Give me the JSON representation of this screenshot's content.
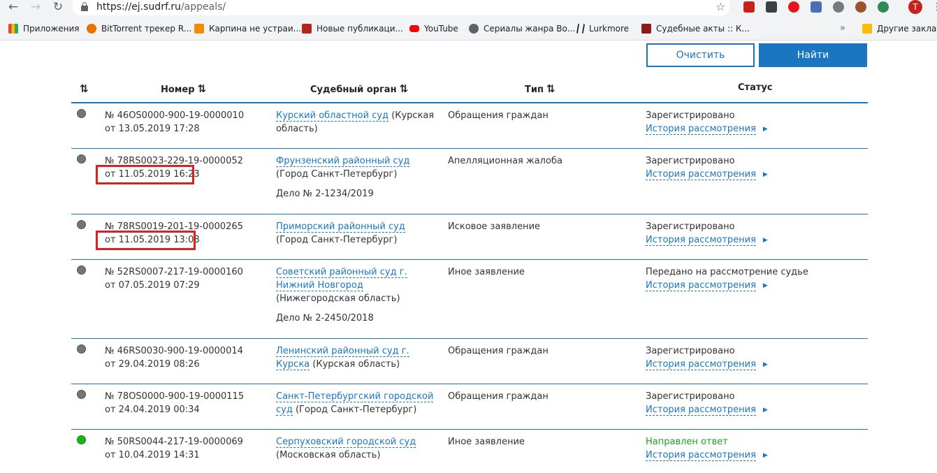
{
  "browser": {
    "url_host": "https://ej.sudrf.ru",
    "url_path": "/appeals/",
    "avatar_letter": "T",
    "bookmarks": [
      {
        "label": "Приложения",
        "icon": "apps-grid-icon",
        "color": "#ea4335"
      },
      {
        "label": "BitTorrent трекер R...",
        "icon": "torrent-icon",
        "color": "#e37400"
      },
      {
        "label": "Карпина не устраи...",
        "icon": "shield-bookmark-icon",
        "color": "#f28b00"
      },
      {
        "label": "Новые публикаци...",
        "icon": "notice-icon",
        "color": "#b3261e"
      },
      {
        "label": "YouTube",
        "icon": "youtube-icon",
        "color": "#ff0000"
      },
      {
        "label": "Сериалы жанра Во...",
        "icon": "globe-icon",
        "color": "#5f6368"
      },
      {
        "label": "Lurkmore",
        "icon": "lurkmore-icon",
        "color": "#202124"
      },
      {
        "label": "Судебные акты :: К...",
        "icon": "court-acts-icon",
        "color": "#8b1a1a"
      }
    ],
    "more_bookmarks": "Другие закладк"
  },
  "actions": {
    "clear_label": "Очистить",
    "find_label": "Найти"
  },
  "table": {
    "headers": {
      "number": "Номер",
      "court": "Судебный орган",
      "type": "Тип",
      "status": "Статус"
    },
    "history_label": "История рассмотрения",
    "rows": [
      {
        "number": "№ 46OS0000-900-19-0000010",
        "date": "от 13.05.2019 17:28",
        "court_link": "Курский областной суд",
        "court_rest": "(Курская область)",
        "case": "",
        "type": "Обращения граждан",
        "status": "Зарегистрировано",
        "answered": false,
        "highlight": false
      },
      {
        "number": "№ 78RS0023-229-19-0000052",
        "date": "от 11.05.2019 16:23",
        "court_link": "Фрунзенский районный суд",
        "court_rest": "(Город Санкт-Петербург)",
        "case": "Дело № 2-1234/2019",
        "type": "Апелляционная жалоба",
        "status": "Зарегистрировано",
        "answered": false,
        "highlight": true
      },
      {
        "number": "№ 78RS0019-201-19-0000265",
        "date": "от 11.05.2019 13:08",
        "court_link": "Приморский районный суд",
        "court_rest": "(Город Санкт-Петербург)",
        "case": "",
        "type": "Исковое заявление",
        "status": "Зарегистрировано",
        "answered": false,
        "highlight": true
      },
      {
        "number": "№ 52RS0007-217-19-0000160",
        "date": "от 07.05.2019 07:29",
        "court_link": "Советский районный суд г. Нижний Новгород",
        "court_rest": "(Нижегородская область)",
        "case": "Дело № 2-2450/2018",
        "type": "Иное заявление",
        "status": "Передано на рассмотрение судье",
        "answered": false,
        "highlight": false
      },
      {
        "number": "№ 46RS0030-900-19-0000014",
        "date": "от 29.04.2019 08:26",
        "court_link": "Ленинский районный суд г. Курска",
        "court_rest": "(Курская область)",
        "case": "",
        "type": "Обращения граждан",
        "status": "Зарегистрировано",
        "answered": false,
        "highlight": false
      },
      {
        "number": "№ 78OS0000-900-19-0000115",
        "date": "от 24.04.2019 00:34",
        "court_link": "Санкт-Петербургский городской суд",
        "court_rest": "(Город Санкт-Петербург)",
        "case": "",
        "type": "Обращения граждан",
        "status": "Зарегистрировано",
        "answered": false,
        "highlight": false
      },
      {
        "number": "№ 50RS0044-217-19-0000069",
        "date": "от 10.04.2019 14:31",
        "court_link": "Серпуховский городской суд",
        "court_rest": "(Московская область)",
        "case": "",
        "type": "Иное заявление",
        "status": "Направлен ответ",
        "answered": true,
        "highlight": false
      }
    ]
  },
  "colors": {
    "accent": "#1b76c1",
    "highlight": "#e02020",
    "answered": "#1fa01f",
    "pending_dot": "#757575"
  }
}
